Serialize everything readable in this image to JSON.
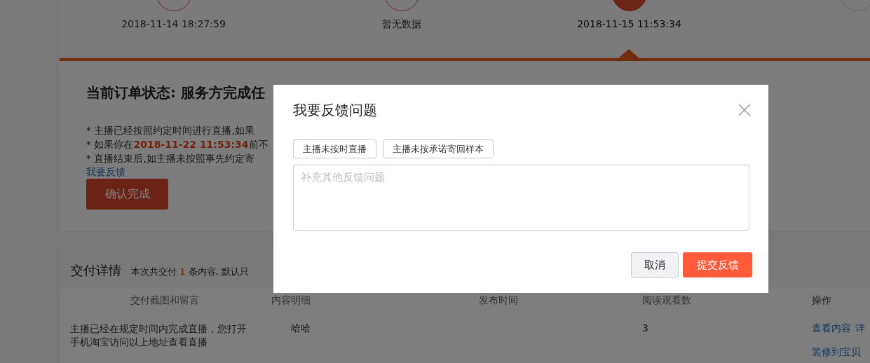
{
  "steps": [
    {
      "time": "2018-11-14 18:27:59",
      "kind": "done"
    },
    {
      "time": "暂无数据",
      "kind": "done"
    },
    {
      "time": "2018-11-15 11:53:34",
      "kind": "current"
    },
    {
      "kind": "pending"
    }
  ],
  "order_status": {
    "title": "当前订单状态: 服务方完成任",
    "notes": [
      "* 主播已经按照约定时间进行直播,如果",
      "* 如果你在**2018-11-22 11:53:34**前不",
      "* 直播结束后,如主播未按照事先约定寄"
    ],
    "feedback_link": "我要反馈",
    "confirm_button": "确认完成"
  },
  "delivery": {
    "title": "交付详情",
    "summary": [
      "本次共交付",
      "1",
      "条内容, 默认只"
    ],
    "columns": [
      "交付截图和留言",
      "内容明细",
      "发布时间",
      "阅读观看数",
      "操作"
    ],
    "rows": [
      {
        "message": "主播已经在规定时间内完成直播，您打开手机淘宝访问以上地址查看直播",
        "detail": "哈哈",
        "views": "3",
        "actions": [
          "查看内容",
          "详",
          "装修到宝贝"
        ]
      }
    ]
  },
  "dialog": {
    "title": "我要反馈问题",
    "options": [
      {
        "label": "主播未按时直播",
        "selected": false
      },
      {
        "label": "主播未按承诺寄回样本",
        "selected": false
      }
    ],
    "placeholder": "补充其他反馈问题",
    "cancel": "取消",
    "submit": "提交反馈"
  }
}
